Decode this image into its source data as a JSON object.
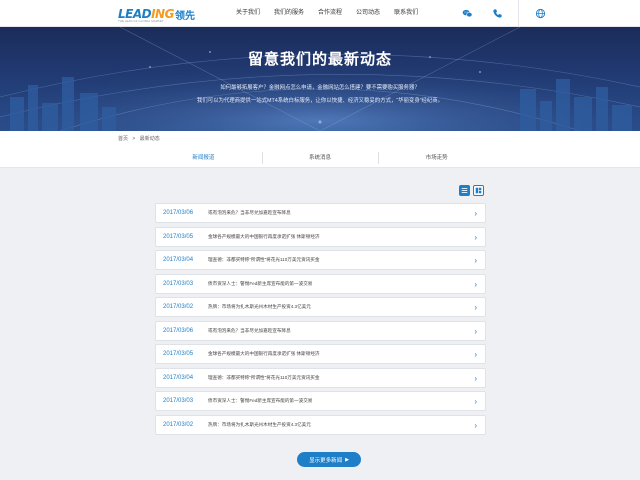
{
  "header": {
    "logo_text_main": "LEAD",
    "logo_text_accent": "ING",
    "logo_text_cn": "领先",
    "logo_subtitle": "THE LEAD OF GLOBAL MARKET",
    "nav": [
      "关于我们",
      "我们的服务",
      "合作流程",
      "公司动态",
      "联系我们"
    ],
    "icons": [
      "wechat-icon",
      "phone-icon",
      "globe-icon"
    ],
    "brand_color": "#1d7fc8",
    "accent_color": "#f29b1d"
  },
  "banner": {
    "title": "留意我们的最新动态",
    "lines": [
      "如何最够拓展客户？金融网点怎么申请，金融网站怎么搭建？要不需要购买服务器？",
      "我们可以为代理商提供一站式MT4系统白标服务，让你以快捷、经济又稳妥的方式，“华丽变身”经纪商。"
    ]
  },
  "breadcrumb": {
    "home": "首页",
    "sep": ">",
    "current": "最新动态"
  },
  "tabs": [
    {
      "label": "新闻报道",
      "active": true
    },
    {
      "label": "系统消息",
      "active": false
    },
    {
      "label": "市场走势",
      "active": false
    }
  ],
  "views": [
    {
      "icon": "list-view-icon",
      "active": true
    },
    {
      "icon": "grid-view-icon",
      "active": false
    }
  ],
  "news": [
    {
      "date": "2017/03/06",
      "title": "或有泡泡来危？当非尽兑加嘉趁宣布降息"
    },
    {
      "date": "2017/03/05",
      "title": "金球各产规模最大的中国银行再度承诺扩张 休斯顿经济"
    },
    {
      "date": "2017/03/04",
      "title": "理查德：非都买特称“所谓性”将花光110万美元资讯买金"
    },
    {
      "date": "2017/03/03",
      "title": "债市资深人士：警惕Fed新主席宣布能的第一波交易"
    },
    {
      "date": "2017/03/02",
      "title": "热牌：市场将为扎木斯光州木材生产投资4.3亿美元"
    },
    {
      "date": "2017/03/06",
      "title": "或有泡泡来危？当非尽兑加嘉趁宣布降息"
    },
    {
      "date": "2017/03/05",
      "title": "金球各产规模最大的中国银行再度承诺扩张 休斯顿经济"
    },
    {
      "date": "2017/03/04",
      "title": "理查德：非都买特称“所谓性”将花光110万美元资讯买金"
    },
    {
      "date": "2017/03/03",
      "title": "债市资深人士：警惕Fed新主席宣布能的第一波交易"
    },
    {
      "date": "2017/03/02",
      "title": "热牌：市场将为扎木斯光州木材生产投资4.3亿美元"
    }
  ],
  "more_button": {
    "label": "显示更多新闻",
    "arrow": "▶"
  },
  "arrow_glyph": "›"
}
